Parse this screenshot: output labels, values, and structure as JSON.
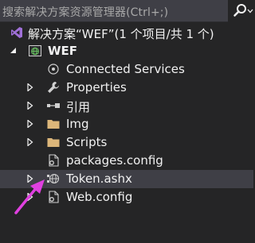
{
  "search": {
    "placeholder": "搜索解决方案资源管理器(Ctrl+;)",
    "icon": "search-icon"
  },
  "tree": {
    "solution": {
      "label": "解决方案“WEF”(1 个项目/共 1 个)",
      "icon": "visual-studio-icon"
    },
    "project": {
      "label": "WEF",
      "icon": "web-project-icon",
      "expanded": true
    },
    "items": [
      {
        "label": "Connected Services",
        "icon": "connected-services-icon",
        "expandable": false
      },
      {
        "label": "Properties",
        "icon": "wrench-icon",
        "expandable": true
      },
      {
        "label": "引用",
        "icon": "references-icon",
        "expandable": true
      },
      {
        "label": "Img",
        "icon": "folder-icon",
        "expandable": true
      },
      {
        "label": "Scripts",
        "icon": "folder-icon",
        "expandable": true
      },
      {
        "label": "packages.config",
        "icon": "config-file-icon",
        "expandable": false
      },
      {
        "label": "Token.ashx",
        "icon": "ashx-handler-icon",
        "expandable": true,
        "selected": true
      },
      {
        "label": "Web.config",
        "icon": "config-file-icon",
        "expandable": true
      }
    ]
  },
  "colors": {
    "background": "#252526",
    "search_bg": "#3f3f46",
    "selected_row": "#3f3f46",
    "folder": "#dcb67a",
    "project_icon": "#68a0d8",
    "vs_purple": "#a070d8",
    "annotation_arrow": "#e040e0"
  }
}
